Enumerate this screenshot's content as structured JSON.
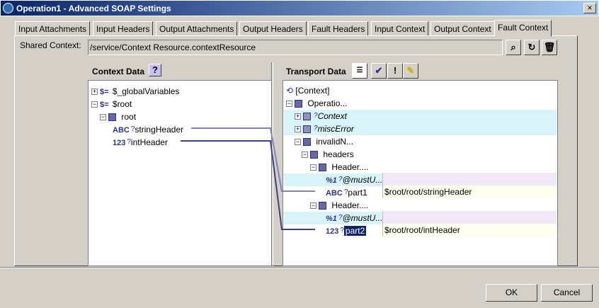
{
  "window": {
    "title": "Operation1 - Advanced SOAP Settings",
    "close": "×"
  },
  "tabs": [
    "Input Attachments",
    "Input Headers",
    "Output Attachments",
    "Output Headers",
    "Fault Headers",
    "Input Context",
    "Output Context",
    "Fault Context"
  ],
  "shared_context": {
    "label": "Shared Context:",
    "value": "/service/Context Resource.contextResource"
  },
  "context_data": {
    "title": "Context Data",
    "help": "?",
    "items": [
      {
        "label": "$_globalVariables",
        "type": "$="
      },
      {
        "label": "$root",
        "type": "$="
      },
      {
        "label": "root",
        "type": ""
      },
      {
        "label": "stringHeader",
        "type": "ABC"
      },
      {
        "label": "intHeader",
        "type": "123"
      }
    ]
  },
  "transport_data": {
    "title": "Transport Data",
    "check": "✔",
    "warn": "!",
    "items": [
      {
        "label": "[Context]"
      },
      {
        "label": "Operatio..."
      },
      {
        "label": "Context"
      },
      {
        "label": "miscError"
      },
      {
        "label": "invalidN..."
      },
      {
        "label": "headers"
      },
      {
        "label": "Header...."
      },
      {
        "label": "@mustU..."
      },
      {
        "label": "part1",
        "value": "$root/root/stringHeader"
      },
      {
        "label": "Header...."
      },
      {
        "label": "@mustU..."
      },
      {
        "label": "part2",
        "value": "$root/root/intHeader"
      }
    ],
    "type_labels": {
      "str": "ABC",
      "int": "123",
      "bool": "%1"
    }
  },
  "buttons": {
    "ok": "OK",
    "cancel": "Cancel"
  }
}
